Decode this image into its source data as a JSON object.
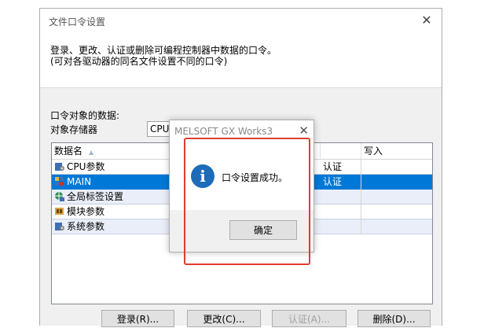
{
  "window": {
    "title": "文件口令设置",
    "close_glyph": "✕",
    "description_line1": "登录、更改、认证或删除可编程控制器中数据的口令。",
    "description_line2": "(可对各驱动器的同名文件设置不同的口令)"
  },
  "form": {
    "data_label": "口令对象的数据:",
    "memory_label": "对象存储器",
    "memory_value": "CPU内置存储器"
  },
  "grid": {
    "columns": [
      "数据名",
      "写入"
    ],
    "sort_glyph": "▲",
    "rows": [
      {
        "name": "CPU参数",
        "icon": "parameter-icon",
        "col_b": "认证",
        "selected": false
      },
      {
        "name": "MAIN",
        "icon": "program-icon",
        "col_b": "认证",
        "selected": true
      },
      {
        "name": "全局标签设置",
        "icon": "global-label-icon",
        "col_b": "",
        "selected": false
      },
      {
        "name": "模块参数",
        "icon": "module-parameter-icon",
        "col_b": "",
        "selected": false
      },
      {
        "name": "系统参数",
        "icon": "parameter-icon",
        "col_b": "",
        "selected": false
      }
    ]
  },
  "buttons": {
    "register": "登录(R)...",
    "change": "更改(C)...",
    "auth": "认证(A)...",
    "delete": "删除(D)..."
  },
  "message_box": {
    "title": "MELSOFT GX Works3",
    "close_glyph": "✕",
    "icon": "info-icon",
    "icon_glyph": "i",
    "text": "口令设置成功。",
    "ok_label": "确定"
  },
  "colors": {
    "selection": "#0078d7",
    "alt_row": "#eaeef8",
    "highlight_box": "#e03c31",
    "info_icon": "#1e6bb8"
  }
}
